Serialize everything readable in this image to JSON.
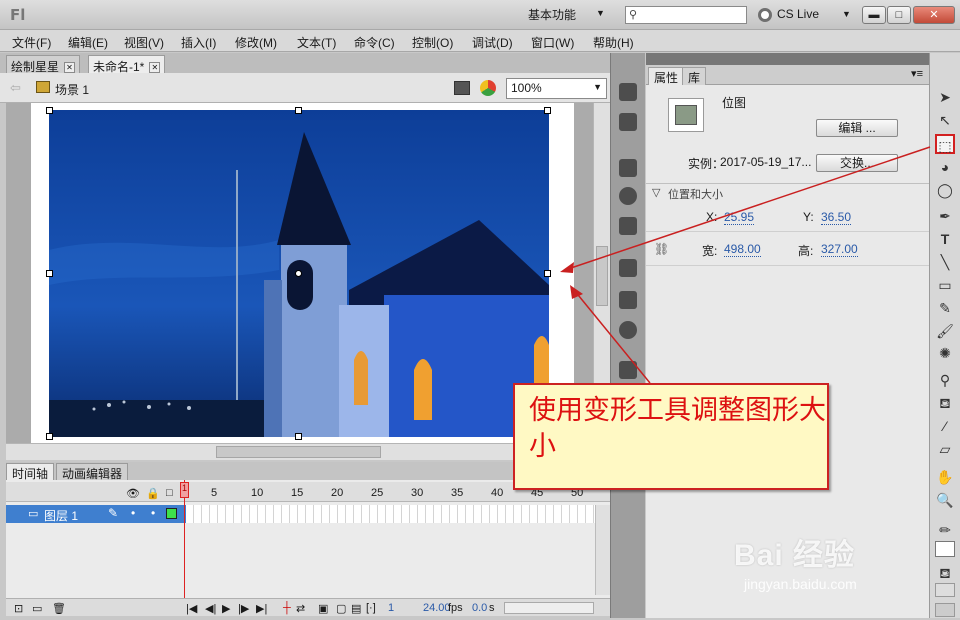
{
  "app": {
    "logo_text": "Fl"
  },
  "titlebar": {
    "workspace": "基本功能",
    "cs_live": "CS Live"
  },
  "menu": [
    "文件(F)",
    "编辑(E)",
    "视图(V)",
    "插入(I)",
    "修改(M)",
    "文本(T)",
    "命令(C)",
    "控制(O)",
    "调试(D)",
    "窗口(W)",
    "帮助(H)"
  ],
  "doc_tabs": [
    {
      "label": "绘制星星",
      "active": false
    },
    {
      "label": "未命名-1*",
      "active": true
    }
  ],
  "edit_bar": {
    "scene": "场景 1",
    "zoom": "100%"
  },
  "timeline_tabs": [
    "时间轴",
    "动画编辑器"
  ],
  "timeline": {
    "frame_numbers": [
      "1",
      "5",
      "10",
      "15",
      "20",
      "25",
      "30",
      "35",
      "40",
      "45",
      "50"
    ],
    "layer_name": "图层 1",
    "current_frame": "1",
    "fps": "24.00",
    "fps_unit": "fps",
    "time": "0.0",
    "time_unit": "s"
  },
  "properties": {
    "tabs": [
      "属性",
      "库"
    ],
    "type": "位图",
    "edit_button": "编辑 ...",
    "instance_label": "实例：",
    "instance_value": "2017-05-19_17...",
    "swap_button": "交换...",
    "section_title": "位置和大小",
    "x_label": "X:",
    "x_value": "25.95",
    "y_label": "Y:",
    "y_value": "36.50",
    "w_label": "宽:",
    "w_value": "498.00",
    "h_label": "高:",
    "h_value": "327.00"
  },
  "annotation": {
    "text": "使用变形工具调整图形大小"
  },
  "watermark": {
    "logo": "Bai 经验",
    "url": "jingyan.baidu.com"
  },
  "colors": {
    "accent_red": "#d22020",
    "callout_bg": "#fff9c4",
    "selected_layer": "#3f7fcf"
  }
}
